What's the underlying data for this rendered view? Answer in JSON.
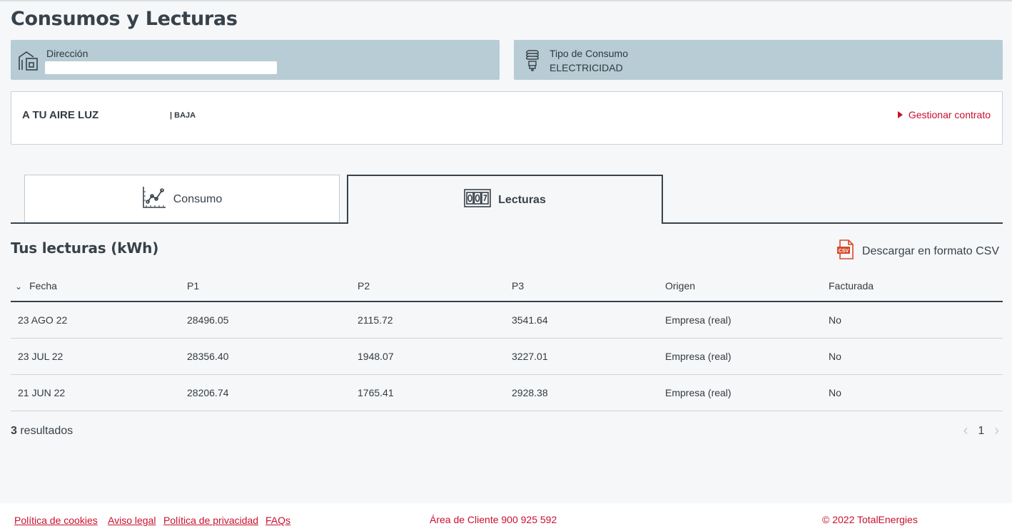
{
  "page": {
    "title": "Consumos y Lecturas"
  },
  "address_card": {
    "label": "Dirección",
    "icon": "building-icon"
  },
  "tipo_card": {
    "label": "Tipo de Consumo",
    "value": "ELECTRICIDAD",
    "icon": "lightbulb-icon"
  },
  "contract": {
    "name": "A TU AIRE LUZ",
    "status": "| BAJA",
    "manage_label": "Gestionar contrato"
  },
  "tabs": [
    {
      "label": "Consumo",
      "icon": "line-chart-icon",
      "active": false
    },
    {
      "label": "Lecturas",
      "icon": "meter-counter-icon",
      "active": true
    }
  ],
  "readings": {
    "title": "Tus lecturas (kWh)",
    "csv_label": "Descargar en formato CSV",
    "csv_icon": "csv-file-icon",
    "columns": [
      "Fecha",
      "P1",
      "P2",
      "P3",
      "Origen",
      "Facturada"
    ],
    "rows": [
      [
        "23 AGO 22",
        "28496.05",
        "2115.72",
        "3541.64",
        "Empresa (real)",
        "No"
      ],
      [
        "23 JUL 22",
        "28356.40",
        "1948.07",
        "3227.01",
        "Empresa (real)",
        "No"
      ],
      [
        "21 JUN 22",
        "28206.74",
        "1765.41",
        "2928.38",
        "Empresa (real)",
        "No"
      ]
    ],
    "results_count": "3",
    "results_label": " resultados",
    "page": "1"
  },
  "footer": {
    "links": [
      "Política de cookies",
      "Aviso legal",
      "Política de privacidad",
      "FAQs"
    ],
    "phone": "Área de Cliente 900 925 592",
    "copyright": "© 2022 TotalEnergies"
  },
  "colors": {
    "accent": "#c8102e",
    "card": "#b7ccd4",
    "dark": "#37424a"
  }
}
